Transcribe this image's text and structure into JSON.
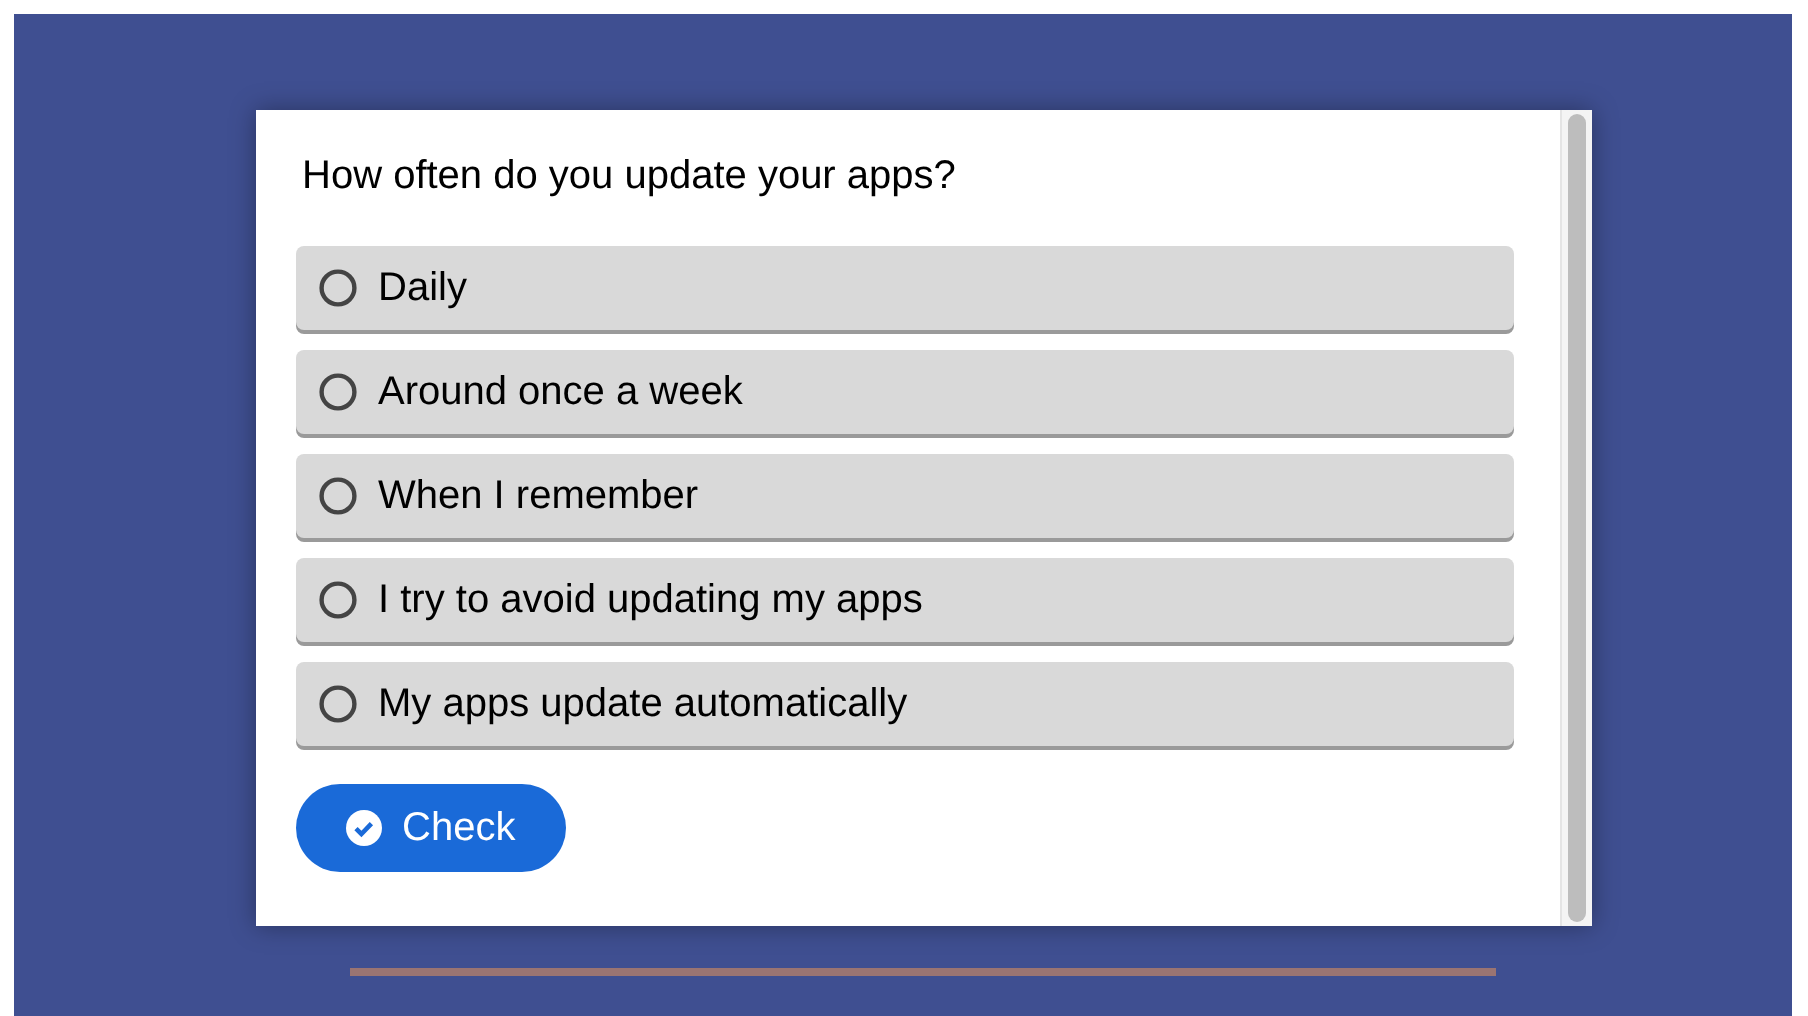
{
  "question": "How often do you update your apps?",
  "options": [
    {
      "label": "Daily",
      "selected": false
    },
    {
      "label": "Around once a week",
      "selected": false
    },
    {
      "label": "When I remember",
      "selected": false
    },
    {
      "label": "I try to avoid updating my apps",
      "selected": false
    },
    {
      "label": "My apps update automatically",
      "selected": false
    }
  ],
  "button": "Check"
}
